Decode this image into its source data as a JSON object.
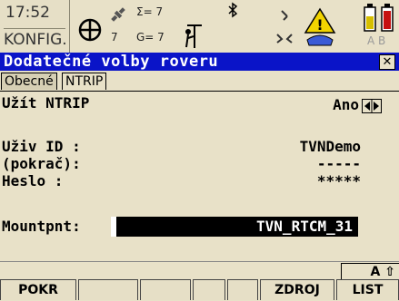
{
  "status": {
    "time": "17:52",
    "mode": "KONFIG.",
    "sat_count_a": "7",
    "sigma_label": "Σ= 7",
    "g_label": "G= 7",
    "battery_letters": "A B"
  },
  "window": {
    "title": "Dodatečné volby roveru",
    "close_glyph": "✕"
  },
  "tabs": [
    {
      "label": "Obecné",
      "active": false
    },
    {
      "label": "NTRIP",
      "active": true
    }
  ],
  "fields": {
    "use_ntrip_label": "Užít NTRIP",
    "use_ntrip_value": "Ano",
    "user_id_label": "Uživ ID   :",
    "user_id_value": "TVNDemo",
    "cont_label": "(pokrač):",
    "cont_value": "-----",
    "password_label": "Heslo    :",
    "password_value": "*****",
    "mountpoint_label": "Mountpnt:",
    "mountpoint_value": "TVN_RTCM_31"
  },
  "shift_indicator": "A ⇧",
  "softkeys": [
    "POKR",
    "",
    "",
    "",
    "",
    "ZDROJ",
    "LIST"
  ]
}
